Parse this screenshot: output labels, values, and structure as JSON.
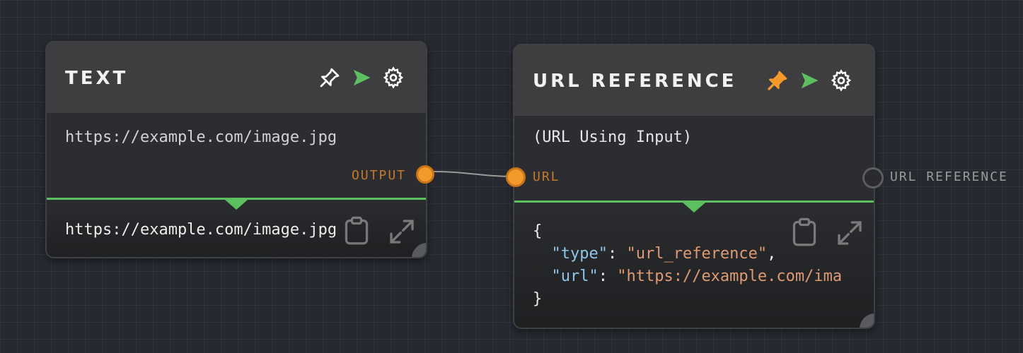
{
  "text_node": {
    "title": "TEXT",
    "input_value": "https://example.com/image.jpg",
    "output_port_label": "OUTPUT",
    "output_preview": "https://example.com/image.jpg"
  },
  "url_node": {
    "title": "URL REFERENCE",
    "description": "(URL Using Input)",
    "input_port_label": "URL",
    "output_port_label": "URL REFERENCE",
    "json_open": "{",
    "json_key_type": "\"type\"",
    "json_val_type": "\"url_reference\"",
    "json_key_url": "\"url\"",
    "json_val_url": "\"https://example.com/ima",
    "json_close": "}"
  },
  "colors": {
    "accent_green": "#5dc060",
    "port_orange": "#f39a2b",
    "pin_active_orange": "#f39a2b"
  }
}
